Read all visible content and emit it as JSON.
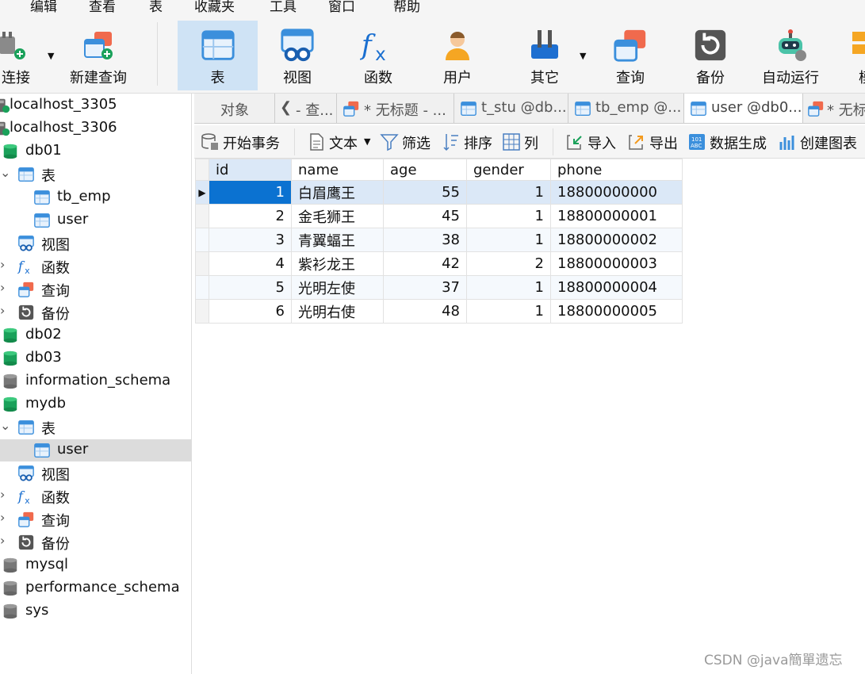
{
  "menubar": {
    "items": [
      "编辑",
      "查看",
      "表",
      "收藏夹",
      "工具",
      "窗口",
      "帮助"
    ]
  },
  "toolbar": {
    "buttons": [
      "连接",
      "新建查询",
      "表",
      "视图",
      "函数",
      "用户",
      "其它",
      "查询",
      "备份",
      "自动运行",
      "模"
    ]
  },
  "sidebar": {
    "connections": [
      "localhost_3305",
      "localhost_3306"
    ],
    "db01": {
      "name": "db01",
      "tables_label": "表",
      "tables": [
        "tb_emp",
        "user"
      ],
      "view": "视图",
      "func": "函数",
      "query": "查询",
      "backup": "备份"
    },
    "mid_dbs": [
      "db02",
      "db03",
      "information_schema",
      "mydb"
    ],
    "mydb": {
      "tables_label": "表",
      "table": "user",
      "view": "视图",
      "func": "函数",
      "query": "查询",
      "backup": "备份"
    },
    "tail_dbs": [
      "mysql",
      "performance_schema",
      "sys"
    ]
  },
  "tabs": [
    "对象",
    "- 查...",
    "* 无标题 - ...",
    "t_stu @db...",
    "tb_emp @...",
    "user @db0...",
    "* 无标"
  ],
  "objbar": {
    "begin_tx": "开始事务",
    "text": "文本",
    "filter": "筛选",
    "sort": "排序",
    "columns": "列",
    "import": "导入",
    "export": "导出",
    "datagen": "数据生成",
    "chart": "创建图表"
  },
  "table": {
    "columns": [
      "id",
      "name",
      "age",
      "gender",
      "phone"
    ],
    "rows": [
      [
        "1",
        "白眉鹰王",
        "55",
        "1",
        "18800000000"
      ],
      [
        "2",
        "金毛狮王",
        "45",
        "1",
        "18800000001"
      ],
      [
        "3",
        "青翼蝠王",
        "38",
        "1",
        "18800000002"
      ],
      [
        "4",
        "紫衫龙王",
        "42",
        "2",
        "18800000003"
      ],
      [
        "5",
        "光明左使",
        "37",
        "1",
        "18800000004"
      ],
      [
        "6",
        "光明右使",
        "48",
        "1",
        "18800000005"
      ]
    ]
  },
  "watermark": "CSDN @java簡單遗忘",
  "colors": {
    "accent": "#0b72d1",
    "selected_tab": "#cfe3f5",
    "db_green": "#1aa15a"
  }
}
